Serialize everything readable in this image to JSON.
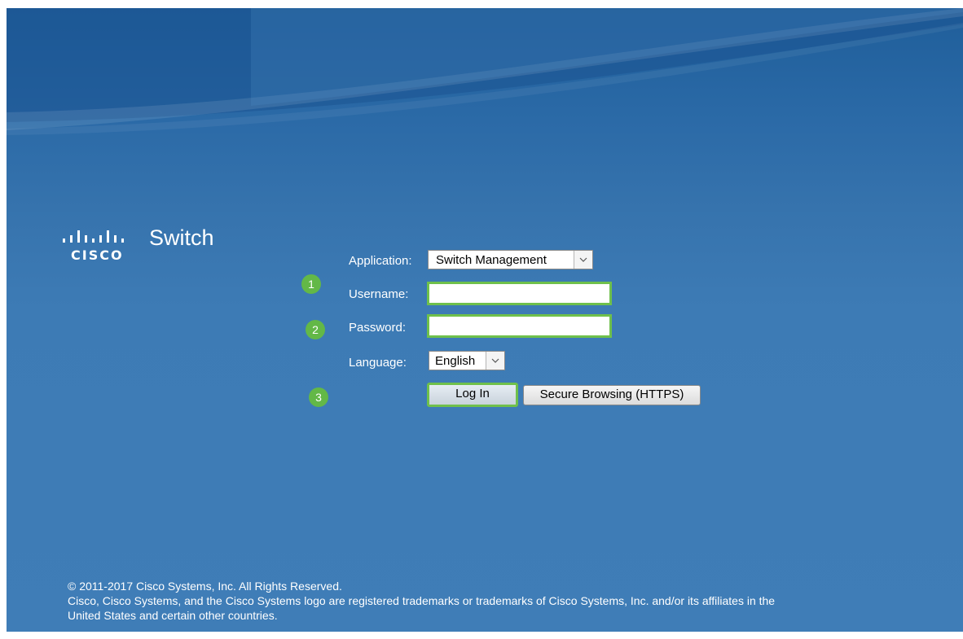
{
  "brand": {
    "logo_text": "CISCO",
    "product_name": "Switch"
  },
  "form": {
    "application": {
      "label": "Application:",
      "selected": "Switch Management"
    },
    "username": {
      "label": "Username:",
      "value": ""
    },
    "password": {
      "label": "Password:",
      "value": ""
    },
    "language": {
      "label": "Language:",
      "selected": "English"
    },
    "login_button": "Log In",
    "secure_button": "Secure Browsing (HTTPS)"
  },
  "steps": [
    "1",
    "2",
    "3"
  ],
  "footer": {
    "copyright": "© 2011-2017 Cisco Systems, Inc. All Rights Reserved.",
    "trademark_line1": "Cisco, Cisco Systems, and the Cisco Systems logo are registered trademarks or trademarks of Cisco Systems, Inc. and/or its affiliates in the",
    "trademark_line2": "United States and certain other countries."
  },
  "colors": {
    "background": "#3d7bb5",
    "highlight_green": "#6fc04b",
    "badge_green": "#63b847",
    "text": "#ffffff"
  }
}
